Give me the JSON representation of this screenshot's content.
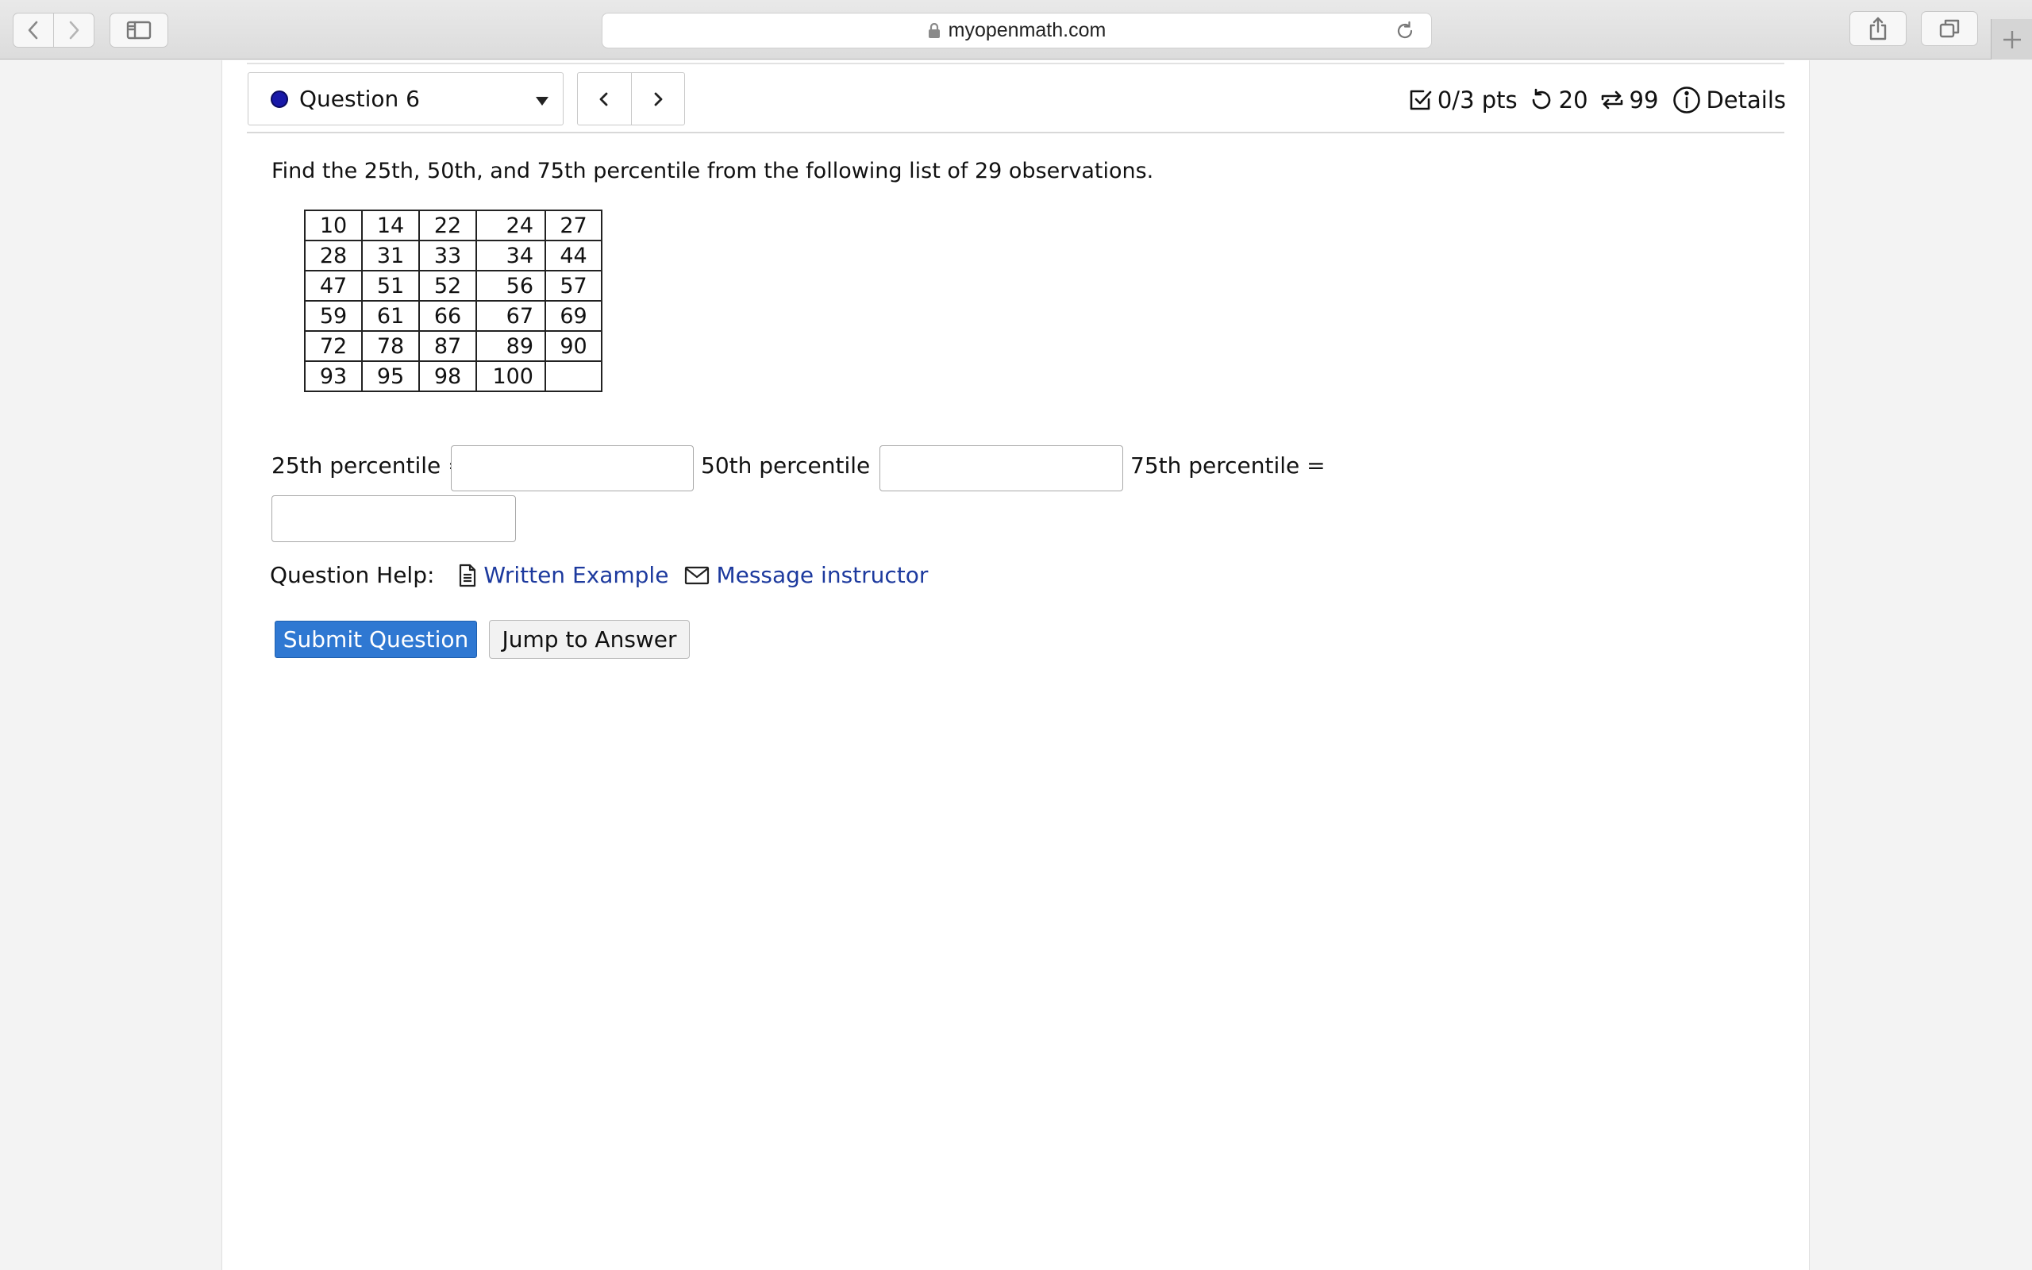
{
  "browser": {
    "url": "myopenmath.com",
    "icons": [
      "back-icon",
      "forward-icon",
      "sidebar-icon",
      "lock-icon",
      "reload-icon",
      "share-icon",
      "tabs-icon",
      "plus-icon"
    ]
  },
  "header": {
    "question_label": "Question 6",
    "status_color": "#1818a8",
    "points": "0/3 pts",
    "retries": "20",
    "versions": "99",
    "details": "Details"
  },
  "question": {
    "prompt": "Find the 25th, 50th, and 75th percentile from the following list of 29 observations.",
    "table": [
      [
        "10",
        "14",
        "22",
        "24",
        "27"
      ],
      [
        "28",
        "31",
        "33",
        "34",
        "44"
      ],
      [
        "47",
        "51",
        "52",
        "56",
        "57"
      ],
      [
        "59",
        "61",
        "66",
        "67",
        "69"
      ],
      [
        "72",
        "78",
        "87",
        "89",
        "90"
      ],
      [
        "93",
        "95",
        "98",
        "100",
        ""
      ]
    ],
    "answers": {
      "p25_label": "25th percentile =",
      "p50_label": "50th percentile =",
      "p75_label": "75th percentile =",
      "p25_value": "",
      "p50_value": "",
      "p75_value": ""
    }
  },
  "help": {
    "label": "Question Help:",
    "written_example": "Written Example",
    "message_instructor": "Message instructor"
  },
  "buttons": {
    "submit": "Submit Question",
    "jump": "Jump to Answer"
  },
  "colors": {
    "submit_bg": "#2f78d2",
    "link": "#1d3a9e"
  }
}
